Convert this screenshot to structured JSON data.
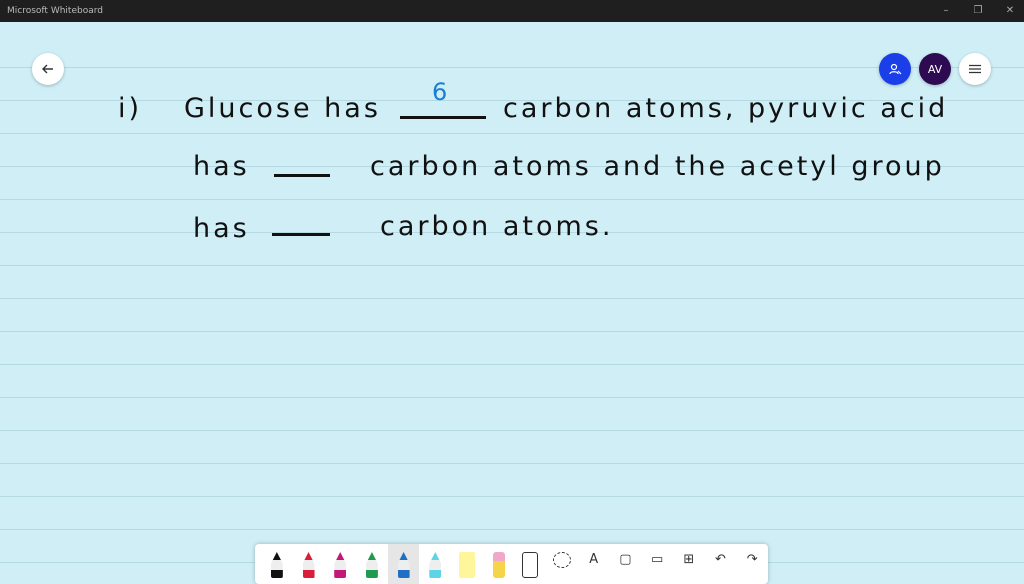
{
  "app": {
    "title": "Microsoft Whiteboard",
    "window_controls": {
      "minimize": "–",
      "restore": "❐",
      "close": "✕"
    }
  },
  "header": {
    "back_icon": "arrow-left-icon",
    "invite_icon": "person-add-icon",
    "avatar_initials": "AV",
    "menu_icon": "hamburger-icon",
    "colors": {
      "invite": "#1a3ee8",
      "avatar": "#2d0a52"
    }
  },
  "board": {
    "line1": {
      "label": "i)",
      "text_a": "Glucose has",
      "answer": "6",
      "text_b": "carbon atoms, pyruvic acid"
    },
    "line2": {
      "text_a": "has",
      "text_b": "carbon atoms and the acetyl group"
    },
    "line3": {
      "text_a": "has",
      "text_b": "carbon atoms."
    },
    "ink_color": "#111111",
    "answer_color": "#1a7fd0"
  },
  "toolbar": {
    "tools": [
      {
        "name": "black-pen",
        "color": "#111111"
      },
      {
        "name": "red-pen",
        "color": "#d81e3a"
      },
      {
        "name": "magenta-pen",
        "color": "#c4177a"
      },
      {
        "name": "green-pen",
        "color": "#1f9a4f"
      },
      {
        "name": "blue-pen",
        "color": "#1f6fc4",
        "selected": true
      },
      {
        "name": "cyan-pen",
        "color": "#5fd3e8"
      },
      {
        "name": "highlighter",
        "color": "#fff59a"
      },
      {
        "name": "eraser",
        "color": "#f1a7c9"
      }
    ],
    "ruler_icon": "ruler-icon",
    "lasso_icon": "lasso-icon",
    "text_tool": "A",
    "note_icon": "sticky-note-icon",
    "image_icon": "image-icon",
    "insert_icon": "plus-box-icon",
    "undo": "↶",
    "redo": "↷"
  }
}
